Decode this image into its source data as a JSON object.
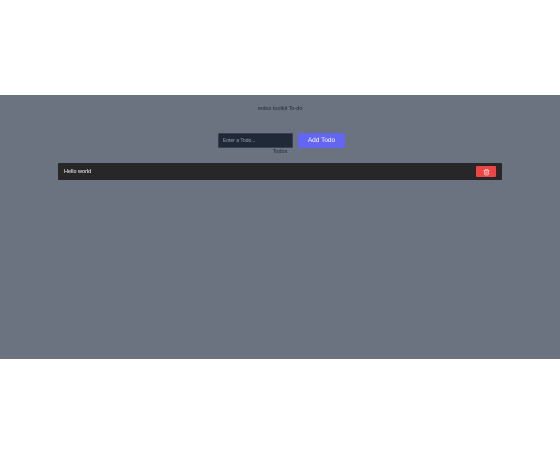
{
  "app": {
    "title": "redux toolkit To-do"
  },
  "form": {
    "input_value": "",
    "input_placeholder": "Enter a Todo...",
    "add_label": "Add Todo"
  },
  "todos": {
    "heading": "Todos",
    "items": [
      {
        "text": "Hello world",
        "delete_icon": "trash-icon"
      }
    ]
  },
  "colors": {
    "app_background": "#6b7280",
    "input_background": "#1f2937",
    "add_button": "#6366f1",
    "todo_row": "#27272a",
    "delete_button": "#ef4444"
  }
}
